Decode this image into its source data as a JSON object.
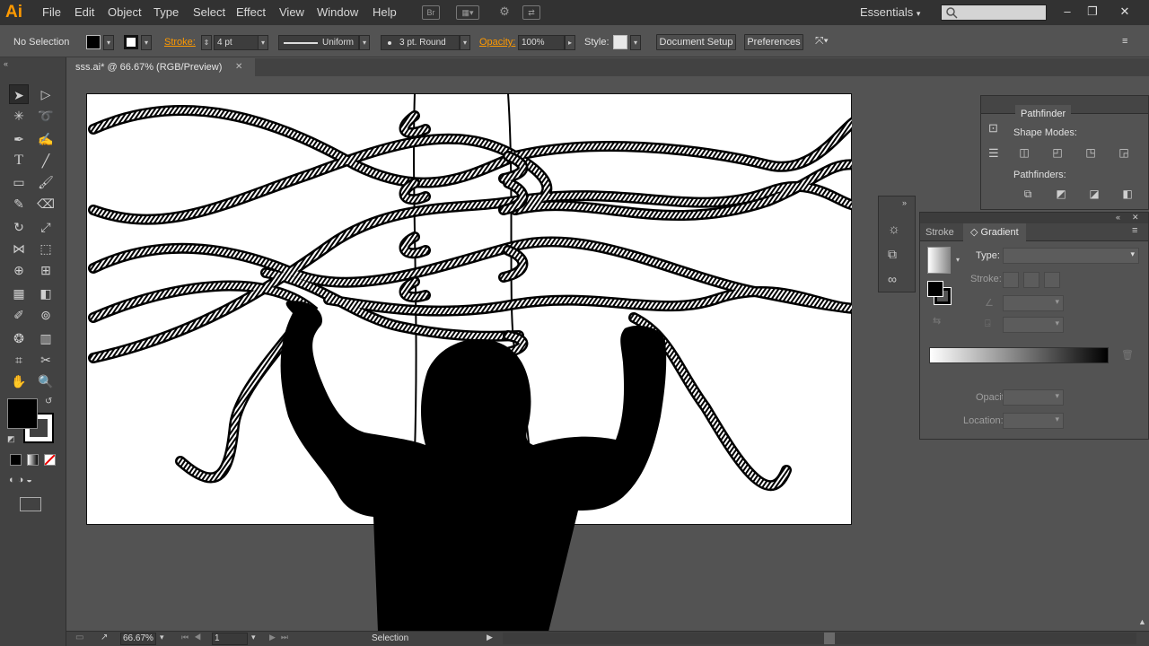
{
  "app": {
    "logo": "Ai"
  },
  "menu": [
    "File",
    "Edit",
    "Object",
    "Type",
    "Select",
    "Effect",
    "View",
    "Window",
    "Help"
  ],
  "appbar": {
    "bridge_label": "Br",
    "workspace": "Essentials"
  },
  "control": {
    "selection": "No Selection",
    "stroke_label": "Stroke:",
    "stroke_weight": "4 pt",
    "profile": "Uniform",
    "brush": "3 pt. Round",
    "opacity_label": "Opacity:",
    "opacity": "100%",
    "style_label": "Style:",
    "doc_setup": "Document Setup",
    "preferences": "Preferences"
  },
  "document": {
    "tab_title": "sss.ai* @ 66.67% (RGB/Preview)"
  },
  "pathfinder": {
    "title": "Pathfinder",
    "shape_modes": "Shape Modes:",
    "pathfinders": "Pathfinders:"
  },
  "gradient_panel": {
    "tab_stroke": "Stroke",
    "tab_gradient": "Gradient",
    "type_label": "Type:",
    "stroke_label": "Stroke:",
    "opacity_label": "Opacity:",
    "location_label": "Location:"
  },
  "status": {
    "zoom": "66.67%",
    "artboard": "1",
    "tool": "Selection"
  },
  "colors": {
    "accent": "#ff9a00",
    "ui_dark": "#323232",
    "ui_mid": "#535353",
    "canvas": "#ffffff"
  }
}
